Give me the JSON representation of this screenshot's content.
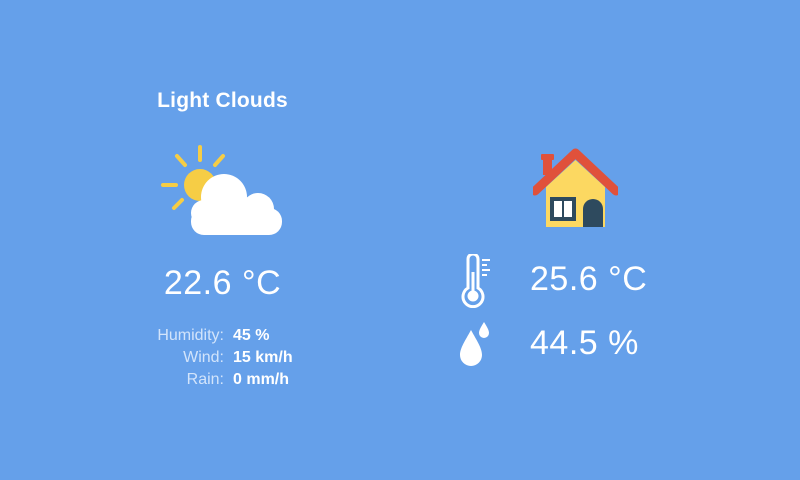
{
  "outdoor": {
    "condition": "Light Clouds",
    "temperature": "22.6 °C",
    "details": [
      {
        "label": "Humidity:",
        "value": "45 %"
      },
      {
        "label": "Wind:",
        "value": "15 km/h"
      },
      {
        "label": "Rain:",
        "value": "0 mm/h"
      }
    ],
    "icon": "sun-behind-cloud-icon"
  },
  "indoor": {
    "icon": "house-icon",
    "temperature": "25.6 °C",
    "temperature_icon": "thermometer-icon",
    "humidity": "44.5 %",
    "humidity_icon": "water-drops-icon"
  },
  "colors": {
    "background": "#65a0ea",
    "sun": "#f6cd45",
    "cloud": "#ffffff",
    "house_roof": "#e0513b",
    "house_wall": "#fcd861",
    "house_door": "#2e4a5e"
  }
}
